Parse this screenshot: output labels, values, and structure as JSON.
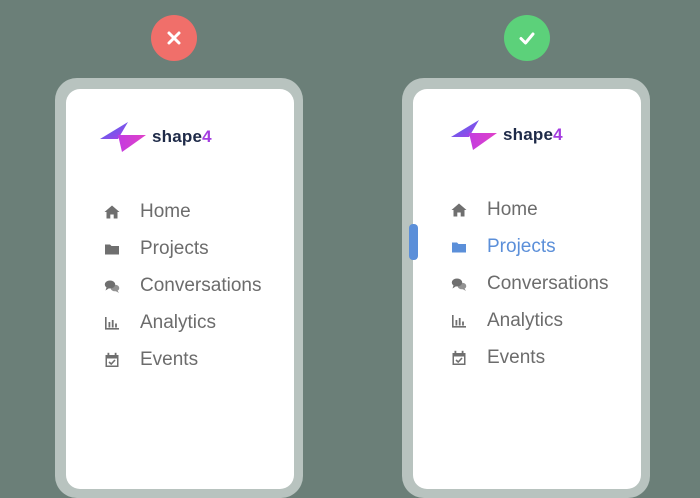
{
  "colors": {
    "background": "#6b7f78",
    "bad_badge": "#f06f6a",
    "good_badge": "#5cd17a",
    "accent": "#5b8fd9",
    "text": "#6c6c6c"
  },
  "badges": {
    "left": {
      "icon": "close-icon"
    },
    "right": {
      "icon": "check-icon"
    }
  },
  "brand": {
    "name": "shape",
    "number": "4"
  },
  "left_panel": {
    "items": [
      {
        "label": "Home",
        "icon": "home-icon"
      },
      {
        "label": "Projects",
        "icon": "folder-icon"
      },
      {
        "label": "Conversations",
        "icon": "chat-icon"
      },
      {
        "label": "Analytics",
        "icon": "analytics-icon"
      },
      {
        "label": "Events",
        "icon": "calendar-icon"
      }
    ]
  },
  "right_panel": {
    "active_index": 1,
    "items": [
      {
        "label": "Home",
        "icon": "home-icon"
      },
      {
        "label": "Projects",
        "icon": "folder-icon"
      },
      {
        "label": "Conversations",
        "icon": "chat-icon"
      },
      {
        "label": "Analytics",
        "icon": "analytics-icon"
      },
      {
        "label": "Events",
        "icon": "calendar-icon"
      }
    ]
  }
}
